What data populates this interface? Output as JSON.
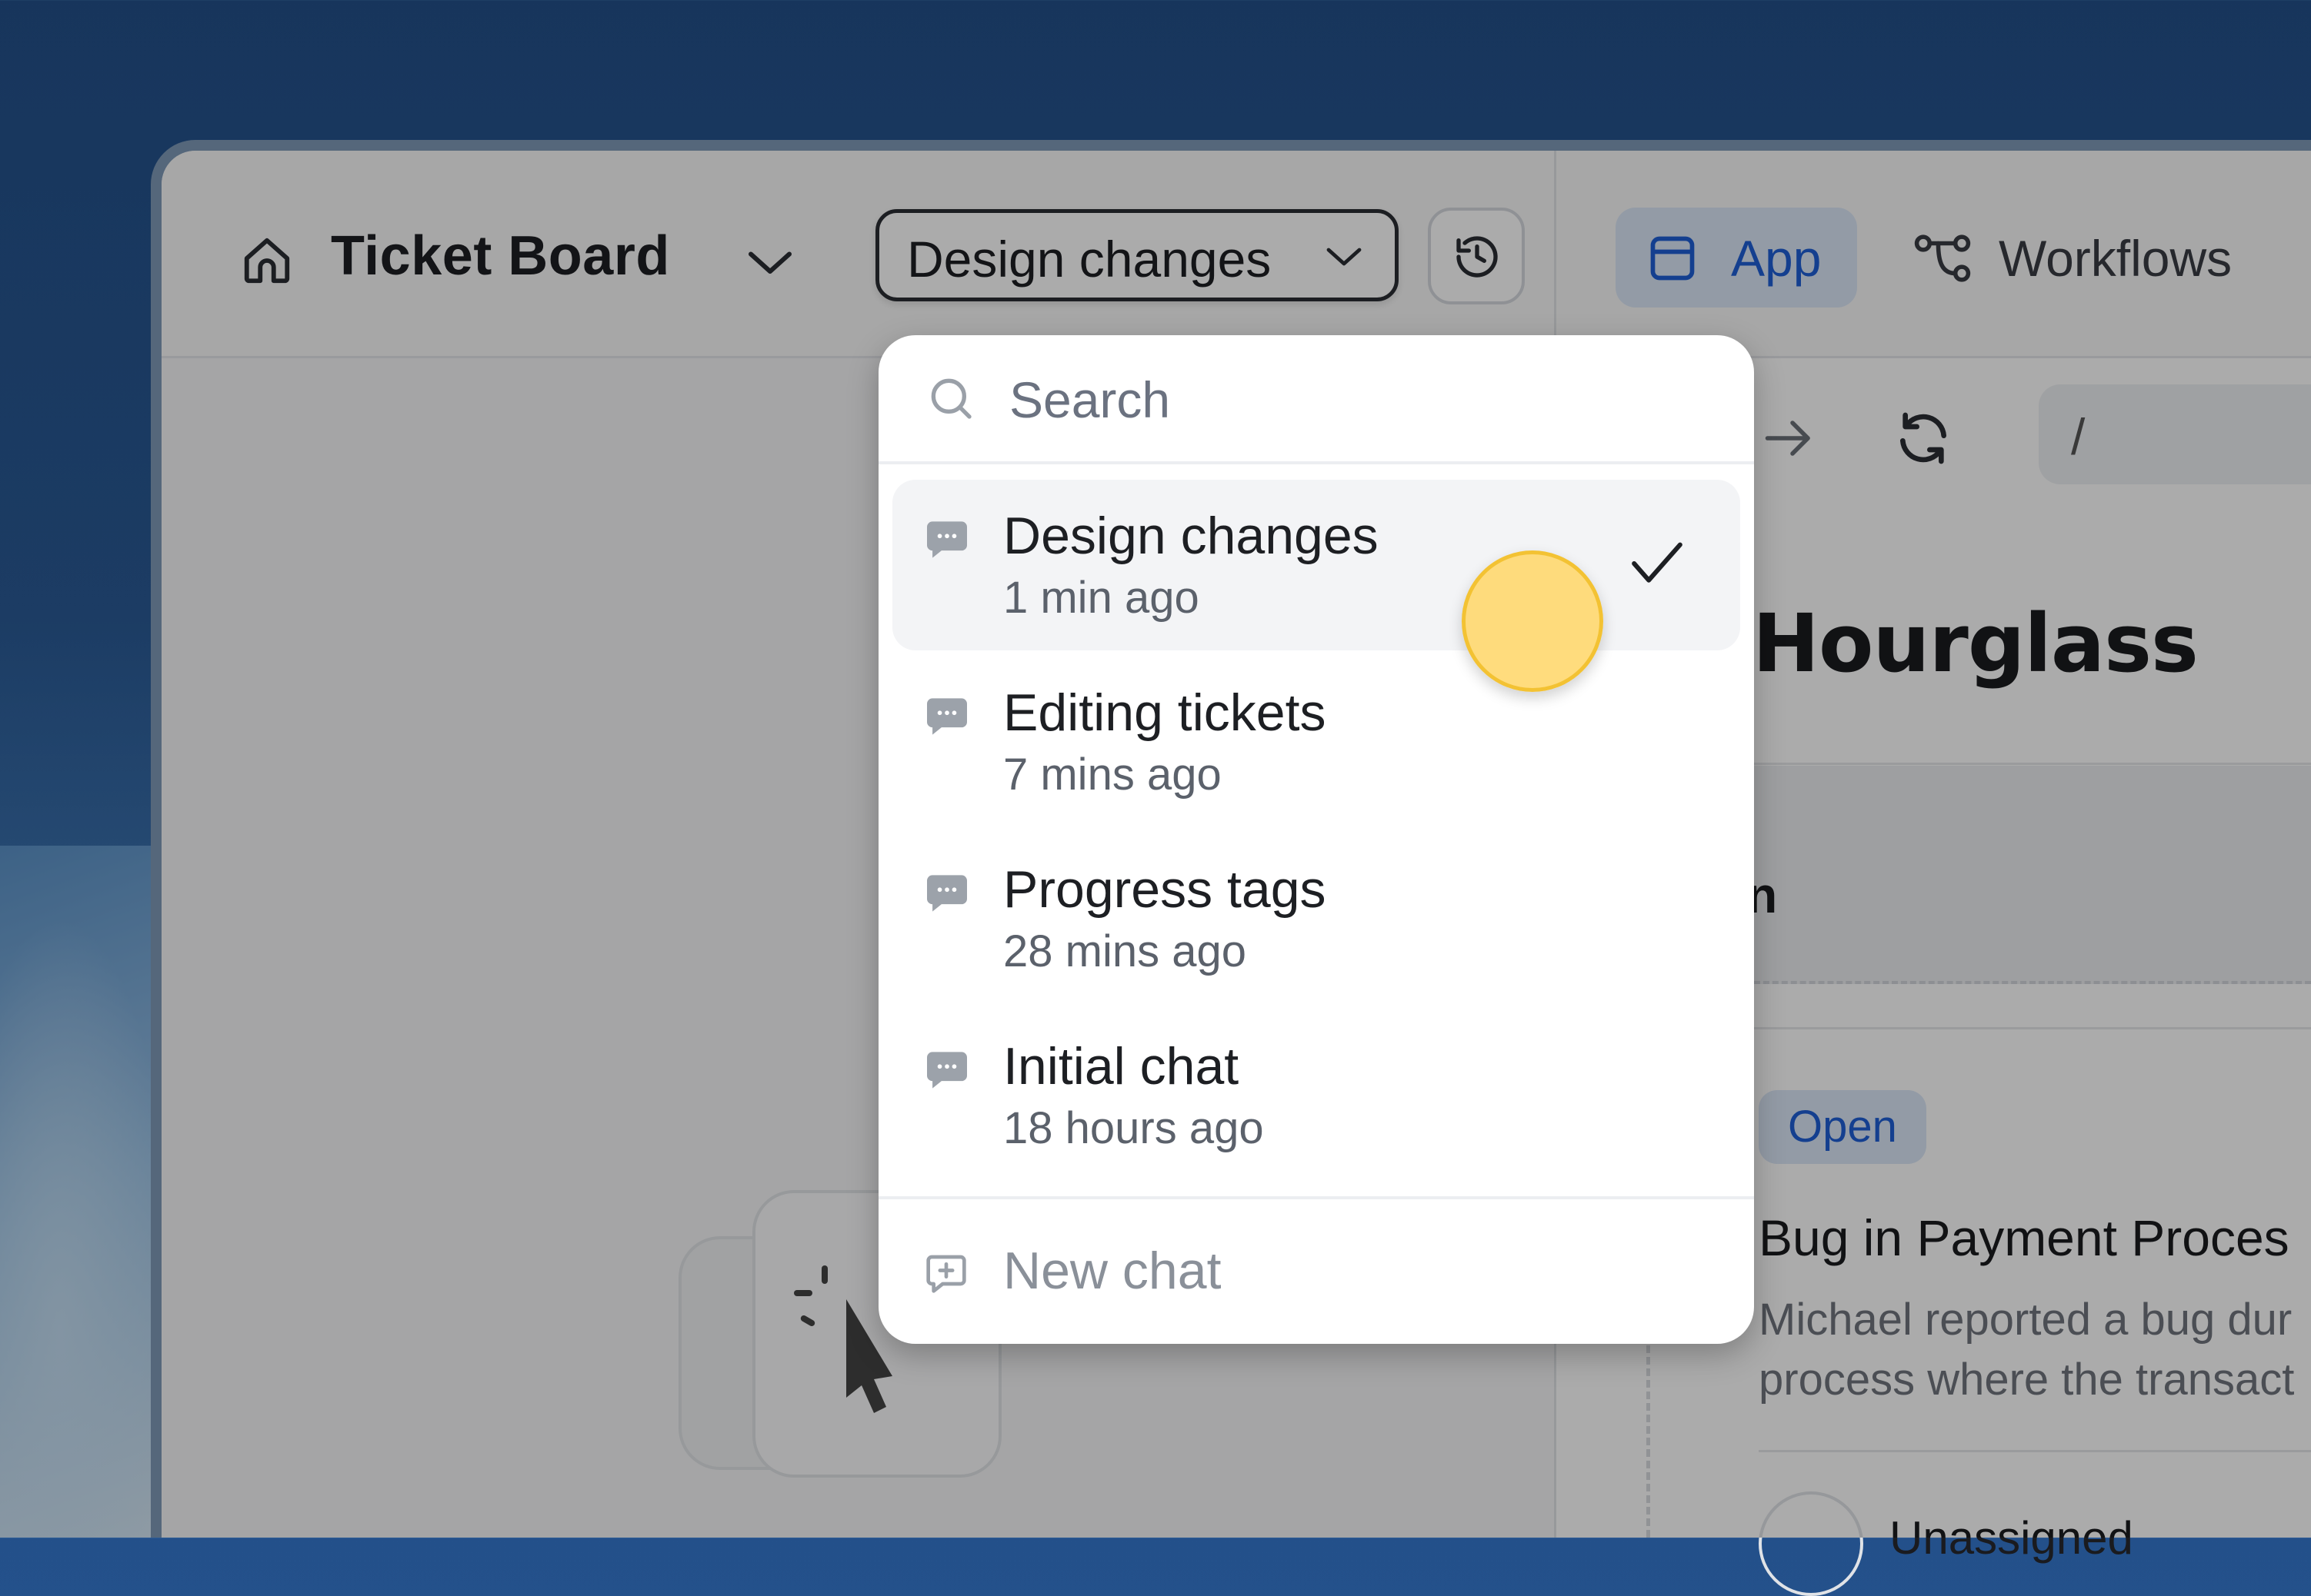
{
  "app": {
    "title": "Ticket Board",
    "chat_selector_label": "Design changes"
  },
  "tabs": [
    {
      "label": "App",
      "active": true
    },
    {
      "label": "Workflows",
      "active": false
    }
  ],
  "preview": {
    "url": "/",
    "brand": "Hourglass",
    "column_fragment": "n",
    "ticket": {
      "status": "Open",
      "title": "Bug in Payment Proces",
      "description_line1": "Michael reported a bug dur",
      "description_line2": "process where the transact",
      "assignee": "Unassigned"
    }
  },
  "dropdown": {
    "search_placeholder": "Search",
    "items": [
      {
        "title": "Design changes",
        "time": "1 min ago",
        "selected": true
      },
      {
        "title": "Editing tickets",
        "time": "7 mins ago",
        "selected": false
      },
      {
        "title": "Progress tags",
        "time": "28 mins ago",
        "selected": false
      },
      {
        "title": "Initial chat",
        "time": "18 hours ago",
        "selected": false
      }
    ],
    "new_chat_label": "New chat"
  },
  "colors": {
    "accent": "#1e5fd6",
    "cursor_highlight": "#ffd666"
  }
}
